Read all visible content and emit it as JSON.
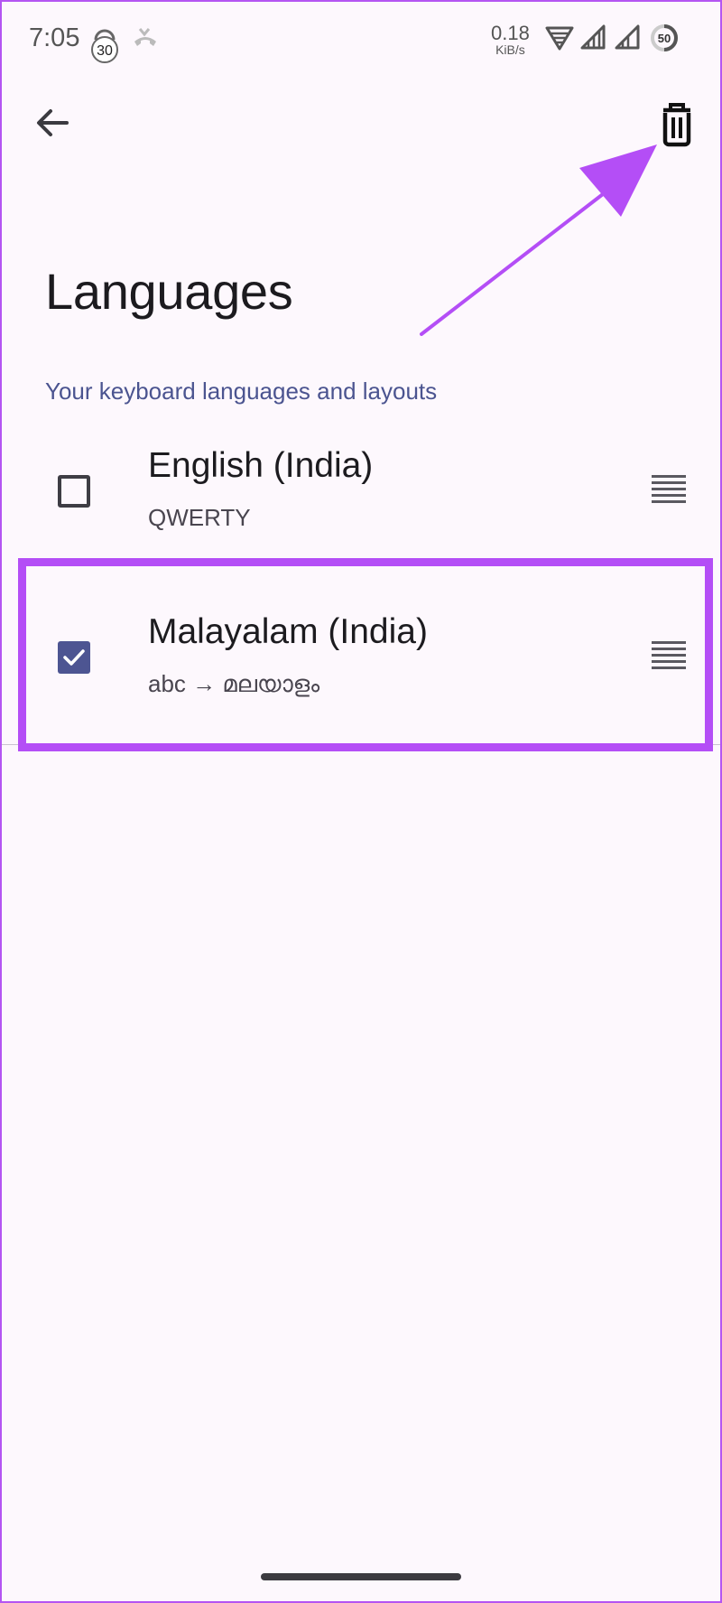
{
  "status_bar": {
    "time": "7:05",
    "alarm_badge": "30",
    "net_speed_value": "0.18",
    "net_speed_unit": "KiB/s",
    "battery_level": "50"
  },
  "app_bar": {
    "back_icon": "arrow-back-icon",
    "delete_icon": "trash-icon"
  },
  "page": {
    "title": "Languages",
    "section_header": "Your keyboard languages and layouts"
  },
  "languages": [
    {
      "name": "English (India)",
      "layout": "QWERTY",
      "checked": false
    },
    {
      "name": "Malayalam (India)",
      "layout": "abc → മലയാളം",
      "checked": true
    }
  ],
  "colors": {
    "accent": "#4d5592",
    "highlight": "#b44ef6",
    "background": "#fdf8fd",
    "section_header": "#4b5490"
  }
}
